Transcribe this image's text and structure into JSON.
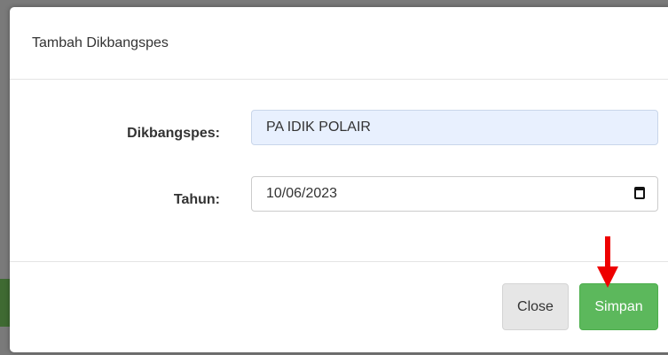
{
  "modal": {
    "title": "Tambah Dikbangspes"
  },
  "form": {
    "dikbangspes_label": "Dikbangspes:",
    "dikbangspes_value": "PA IDIK POLAIR",
    "tahun_label": "Tahun:",
    "tahun_value": "10/06/2023"
  },
  "footer": {
    "close_label": "Close",
    "save_label": "Simpan"
  },
  "colors": {
    "save_button": "#5cb85c",
    "annotation_arrow": "#ee0000",
    "autofill_bg": "#e8f0fe"
  },
  "icons": {
    "date_picker": "calendar-icon",
    "annotation": "down-arrow-icon"
  }
}
